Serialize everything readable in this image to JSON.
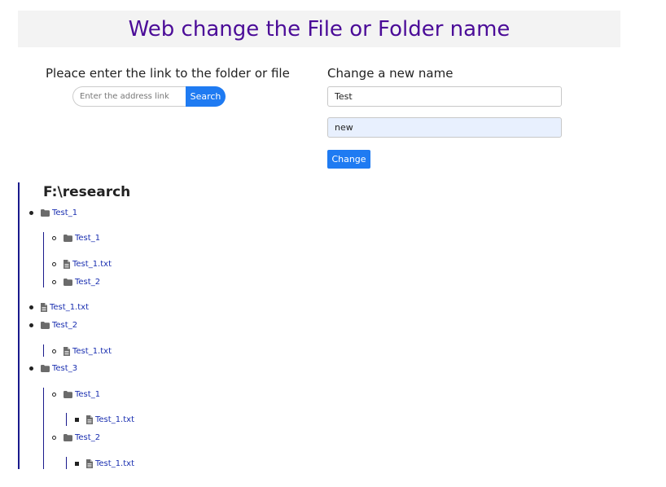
{
  "header": {
    "title": "Web change the File or Folder name"
  },
  "search": {
    "label": "Pleace enter the link to the folder or file",
    "placeholder": "Enter the address link",
    "button_label": "Search"
  },
  "rename": {
    "label": "Change a new name",
    "current_name": "Test",
    "new_name": "new",
    "button_label": "Change"
  },
  "tree": {
    "root_path": "F:\\research",
    "icons": {
      "folder": "folder-icon",
      "file": "file-icon"
    },
    "colors": {
      "link": "#1a2fb0",
      "guide_line": "#1a1a8c",
      "icon": "#6b6b6b"
    },
    "items": [
      {
        "label": "Test_1",
        "type": "folder",
        "depth": 0
      },
      {
        "label": "Test_1",
        "type": "folder",
        "depth": 1
      },
      {
        "label": "Test_1.txt",
        "type": "file",
        "depth": 1
      },
      {
        "label": "Test_2",
        "type": "folder",
        "depth": 1
      },
      {
        "label": "Test_1.txt",
        "type": "file",
        "depth": 0
      },
      {
        "label": "Test_2",
        "type": "folder",
        "depth": 0
      },
      {
        "label": "Test_1.txt",
        "type": "file",
        "depth": 1
      },
      {
        "label": "Test_3",
        "type": "folder",
        "depth": 0
      },
      {
        "label": "Test_1",
        "type": "folder",
        "depth": 1
      },
      {
        "label": "Test_1.txt",
        "type": "file",
        "depth": 2
      },
      {
        "label": "Test_2",
        "type": "folder",
        "depth": 1
      },
      {
        "label": "Test_1.txt",
        "type": "file",
        "depth": 2
      }
    ]
  }
}
